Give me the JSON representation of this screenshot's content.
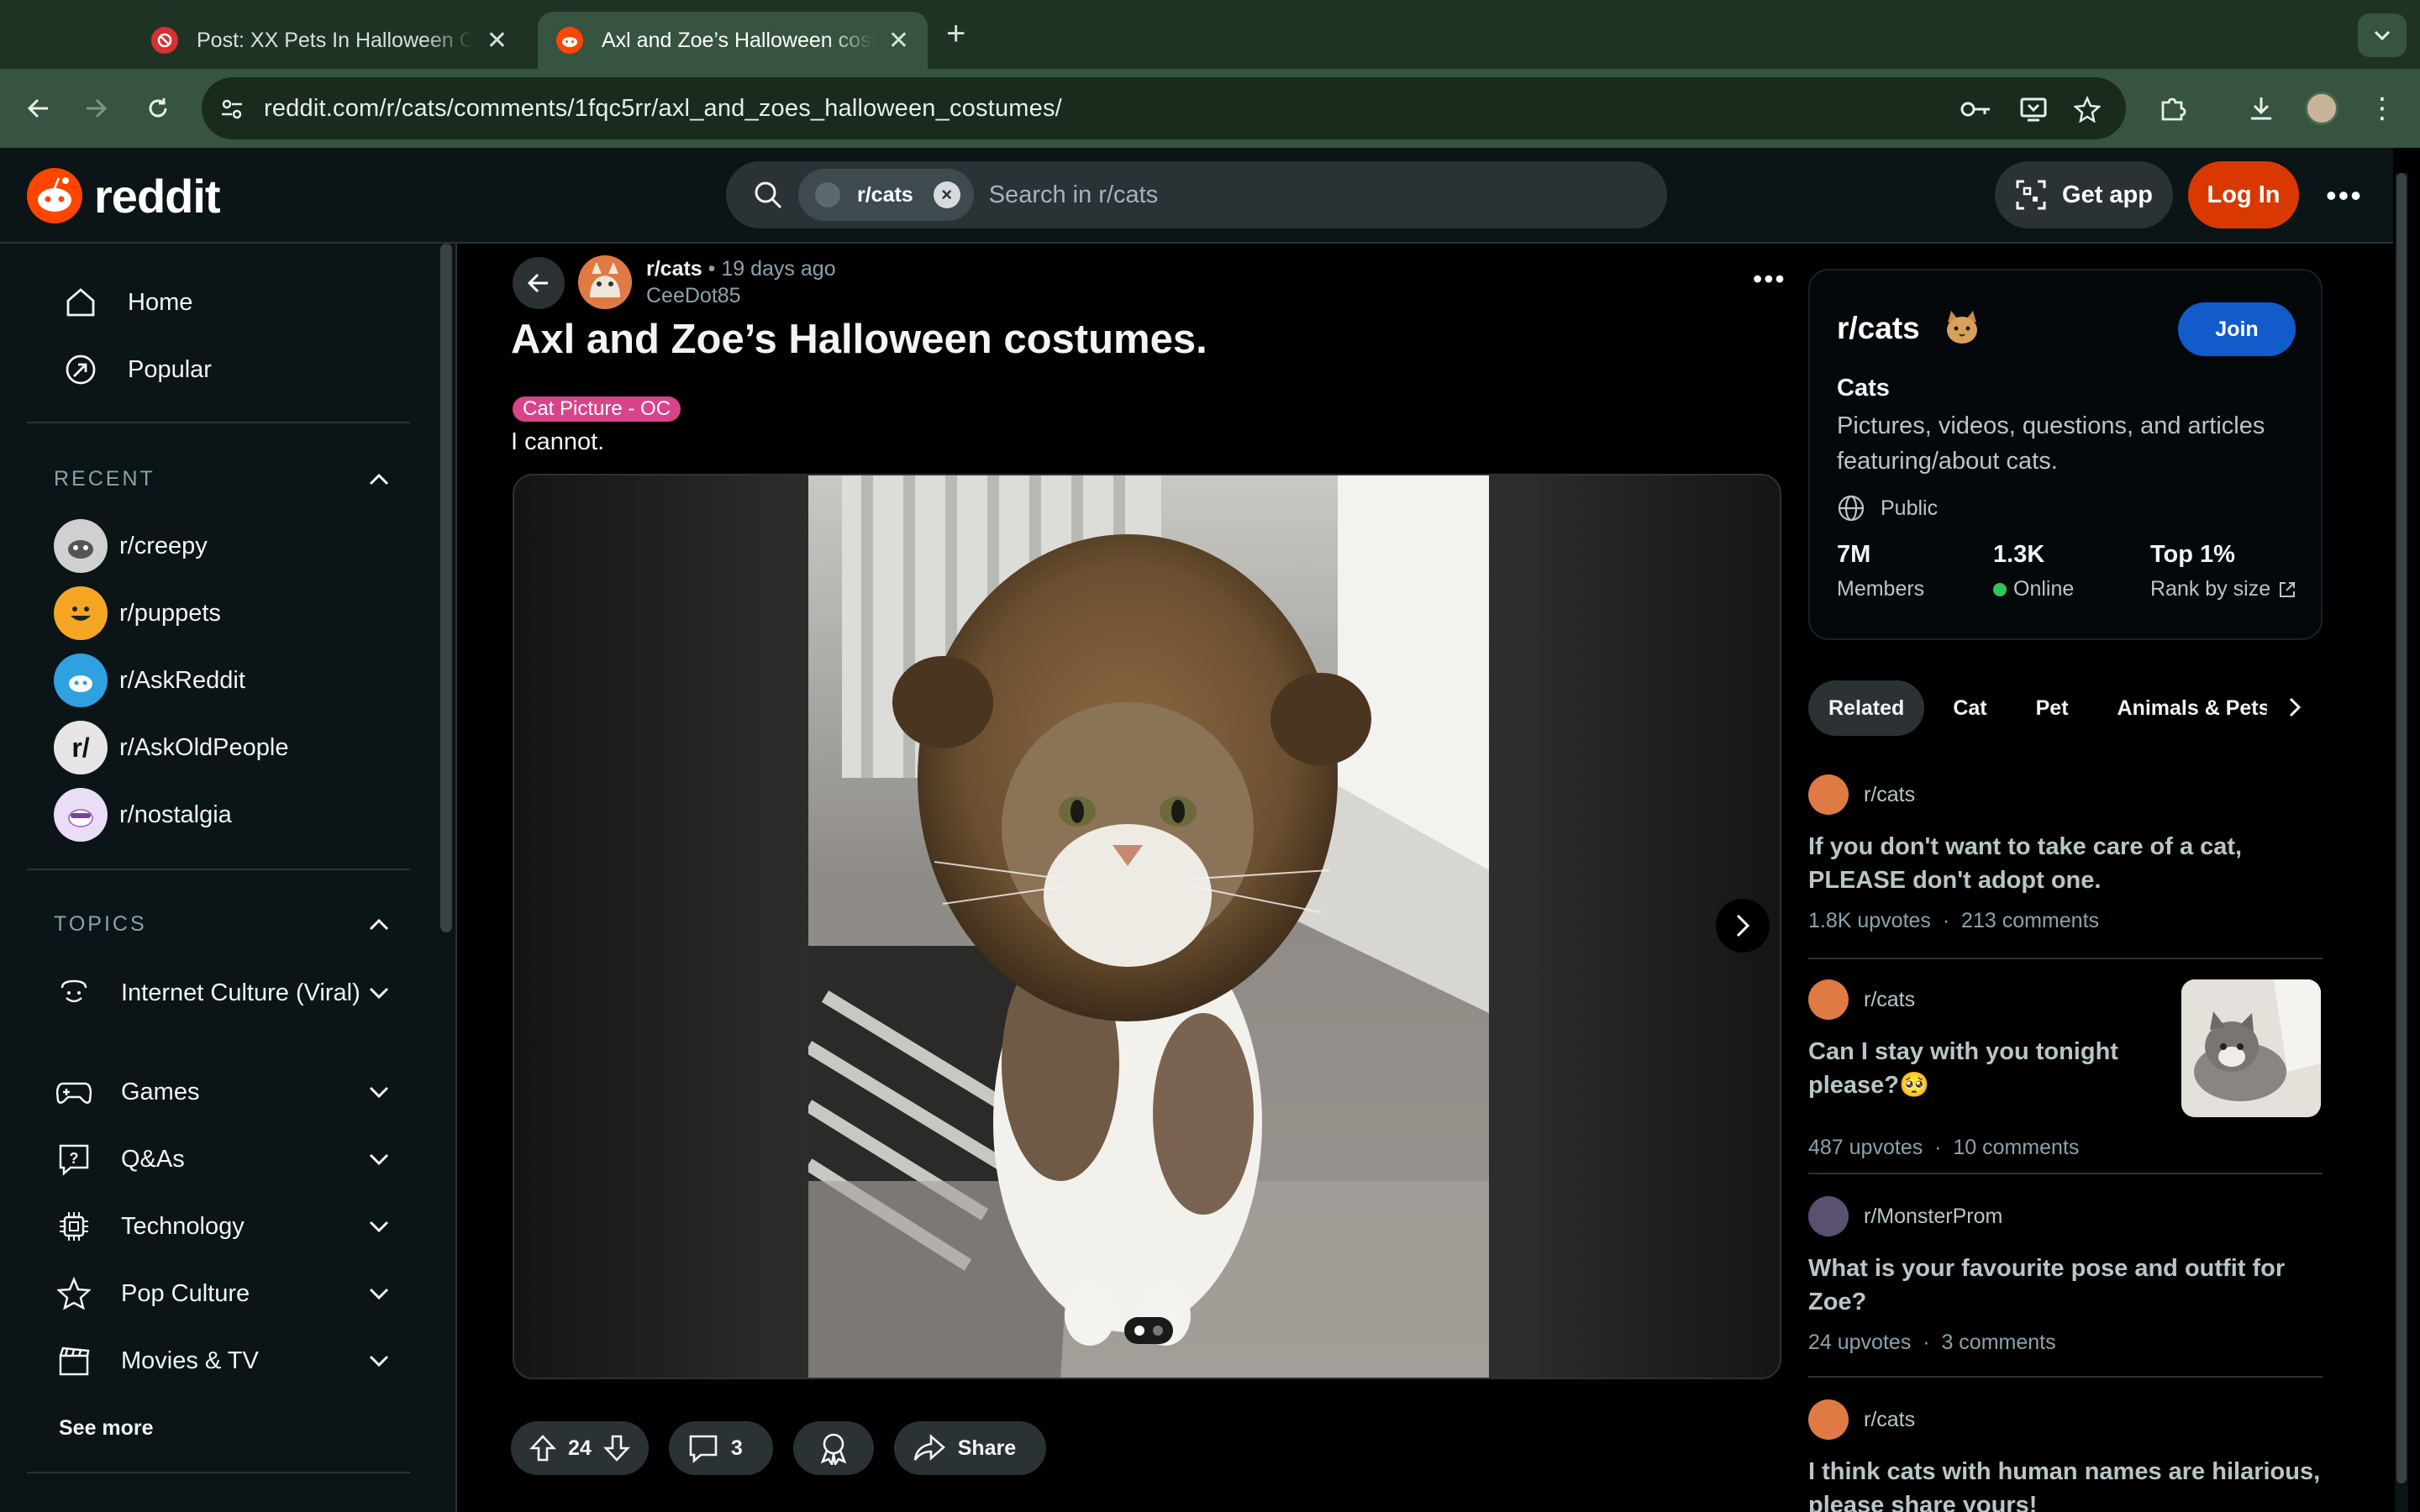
{
  "browser": {
    "tabs": [
      {
        "title": "Post: XX Pets In Halloween Costumes",
        "active": false
      },
      {
        "title": "Axl and Zoe’s Halloween costumes",
        "active": true
      }
    ],
    "url": "reddit.com/r/cats/comments/1fqc5rr/axl_and_zoes_halloween_costumes/"
  },
  "header": {
    "logo_text": "reddit",
    "search_chip": "r/cats",
    "search_placeholder": "Search in r/cats",
    "get_app": "Get app",
    "login": "Log In"
  },
  "sidebar": {
    "nav": [
      {
        "label": "Home",
        "icon": "home-icon"
      },
      {
        "label": "Popular",
        "icon": "popular-icon"
      }
    ],
    "recent_title": "RECENT",
    "recent": [
      {
        "label": "r/creepy"
      },
      {
        "label": "r/puppets"
      },
      {
        "label": "r/AskReddit"
      },
      {
        "label": "r/AskOldPeople"
      },
      {
        "label": "r/nostalgia"
      }
    ],
    "topics_title": "TOPICS",
    "topics": [
      {
        "label": "Internet Culture (Viral)",
        "icon": "smile-icon"
      },
      {
        "label": "Games",
        "icon": "gamepad-icon"
      },
      {
        "label": "Q&As",
        "icon": "question-icon"
      },
      {
        "label": "Technology",
        "icon": "chip-icon"
      },
      {
        "label": "Pop Culture",
        "icon": "star-icon"
      },
      {
        "label": "Movies & TV",
        "icon": "clapper-icon"
      }
    ],
    "see_more": "See more"
  },
  "post": {
    "subreddit": "r/cats",
    "time": "19 days ago",
    "author": "CeeDot85",
    "title": "Axl and Zoe’s Halloween costumes.",
    "flair": "Cat Picture - OC",
    "body": "I cannot.",
    "gallery_index": 1,
    "gallery_count": 2,
    "votes": "24",
    "comments": "3",
    "share": "Share"
  },
  "community": {
    "name": "r/cats",
    "join": "Join",
    "title": "Cats",
    "description": "Pictures, videos, questions, and articles featuring/about cats.",
    "visibility": "Public",
    "stats": [
      {
        "value": "7M",
        "label": "Members"
      },
      {
        "value": "1.3K",
        "label": "Online"
      },
      {
        "value": "Top 1%",
        "label": "Rank by size"
      }
    ]
  },
  "related_tabs": [
    "Related",
    "Cat",
    "Pet",
    "Animals & Pets"
  ],
  "related_posts": [
    {
      "sub": "r/cats",
      "title": "If you don't want to take care of a cat, PLEASE don't adopt one.",
      "upvotes": "1.8K upvotes",
      "comments": "213 comments"
    },
    {
      "sub": "r/cats",
      "title": "Can I stay with you tonight please?🥺",
      "upvotes": "487 upvotes",
      "comments": "10 comments"
    },
    {
      "sub": "r/MonsterProm",
      "title": "What is your favourite pose and outfit for Zoe?",
      "upvotes": "24 upvotes",
      "comments": "3 comments"
    },
    {
      "sub": "r/cats",
      "title": "I think cats with human names are hilarious, please share yours!",
      "upvotes": "",
      "comments": ""
    }
  ],
  "colors": {
    "accent": "#ff4500",
    "login": "#d93900",
    "join": "#115bca",
    "flair": "#d9438a",
    "bg": "#0b1416"
  }
}
